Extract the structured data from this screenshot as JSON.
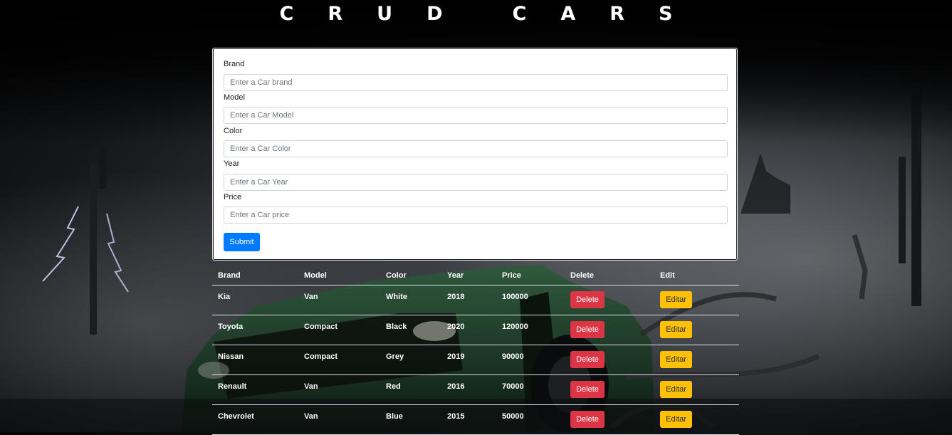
{
  "app": {
    "title_letters": [
      "C",
      "R",
      "U",
      "D",
      " ",
      "C",
      "A",
      "R",
      "S"
    ]
  },
  "form": {
    "fields": [
      {
        "label": "Brand",
        "placeholder": "Enter a Car brand",
        "value": ""
      },
      {
        "label": "Model",
        "placeholder": "Enter a Car Model",
        "value": ""
      },
      {
        "label": "Color",
        "placeholder": "Enter a Car Color",
        "value": ""
      },
      {
        "label": "Year",
        "placeholder": "Enter a Car Year",
        "value": ""
      },
      {
        "label": "Price",
        "placeholder": "Enter a Car price",
        "value": ""
      }
    ],
    "submit_label": "Submit"
  },
  "table": {
    "headers": [
      "Brand",
      "Model",
      "Color",
      "Year",
      "Price",
      "Delete",
      "Edit"
    ],
    "delete_label": "Delete",
    "edit_label": "Editar",
    "rows": [
      {
        "brand": "Kia",
        "model": "Van",
        "color": "White",
        "year": "2018",
        "price": "100000"
      },
      {
        "brand": "Toyota",
        "model": "Compact",
        "color": "Black",
        "year": "2020",
        "price": "120000"
      },
      {
        "brand": "Nissan",
        "model": "Compact",
        "color": "Grey",
        "year": "2019",
        "price": "90000"
      },
      {
        "brand": "Renault",
        "model": "Van",
        "color": "Red",
        "year": "2016",
        "price": "70000"
      },
      {
        "brand": "Chevrolet",
        "model": "Van",
        "color": "Blue",
        "year": "2015",
        "price": "50000"
      }
    ]
  },
  "colors": {
    "primary": "#007bff",
    "danger": "#dc3545",
    "warning": "#ffc107"
  }
}
